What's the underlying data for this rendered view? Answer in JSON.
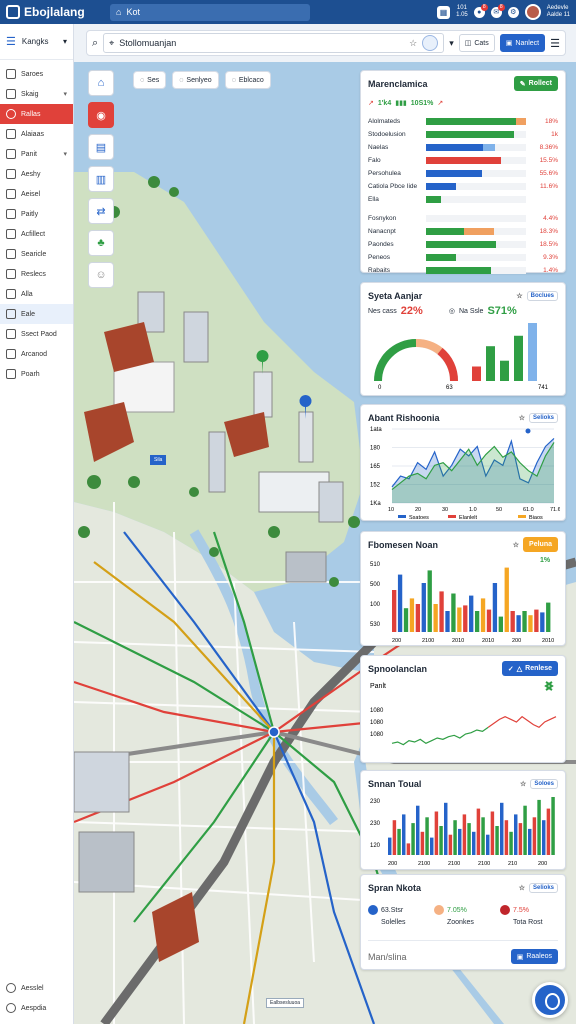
{
  "app": {
    "title": "Ebojlalang",
    "tab": "Kot"
  },
  "topbar": {
    "stack_line1": "101",
    "stack_line2": "1.05",
    "badge1": "8",
    "badge2": "8",
    "user_line1": "Aedevle",
    "user_line2": "Aalde 11"
  },
  "sidebar": {
    "header": "Kangks",
    "items": [
      {
        "label": "Saroes",
        "state": ""
      },
      {
        "label": "Skaig",
        "state": "caret"
      },
      {
        "label": "Rallas",
        "state": "active"
      },
      {
        "label": "Alaiaas",
        "state": ""
      },
      {
        "label": "Panit",
        "state": "caret"
      },
      {
        "label": "Aeshy",
        "state": ""
      },
      {
        "label": "Aeisel",
        "state": ""
      },
      {
        "label": "Paitly",
        "state": ""
      },
      {
        "label": "Acfillect",
        "state": ""
      },
      {
        "label": "Searicle",
        "state": ""
      },
      {
        "label": "Reslecs",
        "state": ""
      },
      {
        "label": "Alla",
        "state": ""
      },
      {
        "label": "Eale",
        "state": "hl"
      },
      {
        "label": "Ssect Paod",
        "state": ""
      },
      {
        "label": "Arcanod",
        "state": ""
      },
      {
        "label": "Poarh",
        "state": ""
      }
    ],
    "footer": [
      {
        "label": "Aesslel"
      },
      {
        "label": "Aespdia"
      }
    ]
  },
  "search": {
    "value": "Stollomuanjan",
    "btn_cats": "Cats",
    "btn_primary": "Nanlect"
  },
  "chips": [
    "Ses",
    "Senlyeo",
    "Eblcaco"
  ],
  "map": {
    "labels": {
      "station": "Sila",
      "bottom": "Ealbsesluuoa"
    }
  },
  "panels": {
    "p1": {
      "title": "Marenclamica",
      "button": "Rollect",
      "header_left": "1'k4",
      "header_pct": "10S1%",
      "rows": [
        {
          "label": "Alolmateds",
          "value": "18%",
          "segs": [
            {
              "c": "#2f9e44",
              "w": 0.9
            },
            {
              "c": "#f0a060",
              "w": 0.1
            }
          ]
        },
        {
          "label": "Stodoelusion",
          "value": "1k",
          "segs": [
            {
              "c": "#2f9e44",
              "w": 0.88
            }
          ]
        },
        {
          "label": "Naelas",
          "value": "8.36%",
          "segs": [
            {
              "c": "#2563c9",
              "w": 0.57
            },
            {
              "c": "#7fb2ea",
              "w": 0.12
            }
          ]
        },
        {
          "label": "Falo",
          "value": "15.5%",
          "segs": [
            {
              "c": "#e0413a",
              "w": 0.75
            }
          ]
        },
        {
          "label": "Persohulea",
          "value": "55.6%",
          "segs": [
            {
              "c": "#2563c9",
              "w": 0.56
            }
          ]
        },
        {
          "label": "Catiola Pbce Iide",
          "value": "11.6%",
          "segs": [
            {
              "c": "#2563c9",
              "w": 0.3
            }
          ]
        },
        {
          "label": "Ella",
          "value": "",
          "segs": [
            {
              "c": "#2f9e44",
              "w": 0.15
            }
          ]
        }
      ],
      "rows2": [
        {
          "label": "Fosnykon",
          "value": "4.4%",
          "segs": []
        },
        {
          "label": "Nanacnpt",
          "value": "18.3%",
          "segs": [
            {
              "c": "#2f9e44",
              "w": 0.38
            },
            {
              "c": "#f0a060",
              "w": 0.3
            }
          ]
        },
        {
          "label": "Paondes",
          "value": "18.5%",
          "segs": [
            {
              "c": "#2f9e44",
              "w": 0.7
            }
          ]
        },
        {
          "label": "Peneos",
          "value": "9.3%",
          "segs": [
            {
              "c": "#2f9e44",
              "w": 0.3
            }
          ]
        },
        {
          "label": "Rabaits",
          "value": "1.4%",
          "segs": [
            {
              "c": "#2f9e44",
              "w": 0.65
            }
          ]
        }
      ]
    },
    "p2": {
      "title": "Syeta Aanjar",
      "tab": "Boclues",
      "sub_left": "Nes cass",
      "kpi1": "22%",
      "sub_mid": "Na  Ssle",
      "kpi2": "S71%",
      "gauge_left": "0",
      "gauge_right": "63",
      "bars_axis_right": "741"
    },
    "p3": {
      "title": "Abant Rishoonia",
      "tab": "Selioks",
      "legend": "Ssatoes",
      "legend2": "Elanlelt",
      "legend3": "Biaos",
      "yticks": [
        "1ata",
        "180",
        "165",
        "152",
        "1Ka"
      ],
      "xticks": [
        "10",
        "20",
        "30",
        "1.0",
        "50",
        "61.0",
        "71.6"
      ]
    },
    "p4": {
      "title": "Fbomesen Noan",
      "button": "Peluna",
      "kpi": "1%",
      "yticks": [
        "510",
        "500",
        "100",
        "530"
      ],
      "xticks": [
        "200",
        "2100",
        "2010",
        "2010",
        "200",
        "2010"
      ]
    },
    "p5": {
      "title": "Spnoolanclan",
      "button": "Renlese",
      "sub": "Panlt",
      "yticks": [
        "1080",
        "1080",
        "1080"
      ]
    },
    "p6": {
      "title": "Snnan Toual",
      "tab": "Soloes",
      "yticks": [
        "230",
        "230",
        "120"
      ],
      "xticks": [
        "200",
        "2100",
        "2100",
        "2100",
        "210",
        "200"
      ]
    },
    "p7": {
      "title": "Spran Nkota",
      "tab": "Selioks",
      "s1_val": "63.Stsr",
      "s1_lbl": "Solelles",
      "s2_val": "7.05%",
      "s2_lbl": "Zoonkes",
      "s3_val": "7.5%",
      "s3_lbl": "Tota Rost",
      "footer_text": "Man/slina",
      "footer_btn": "Raaleos"
    }
  },
  "chart_data": [
    {
      "type": "bar",
      "title": "Marenclamica",
      "categories": [
        "Alolmateds",
        "Stodoelusion",
        "Naelas",
        "Falo",
        "Persohulea",
        "Catiola Pbce Iide",
        "Fosnykon",
        "Nanacnpt",
        "Paondes",
        "Peneos",
        "Rabaits"
      ],
      "values": [
        18,
        0,
        8.36,
        15.5,
        55.6,
        11.6,
        4.4,
        18.3,
        18.5,
        9.3,
        1.4
      ]
    },
    {
      "type": "bar",
      "title": "Syeta Aanjar",
      "values": [
        25,
        60,
        35,
        78,
        100
      ],
      "colors": [
        "#e0413a",
        "#2f9e44",
        "#2f9e44",
        "#2f9e44",
        "#7fb2ea"
      ]
    },
    {
      "type": "area",
      "title": "Abant Rishoonia",
      "series": [
        {
          "values": [
            142,
            150,
            148,
            160,
            155,
            168,
            150,
            158,
            170,
            165,
            172,
            150,
            162,
            158,
            176,
            148,
            145,
            160,
            172,
            178
          ]
        },
        {
          "values": [
            140,
            145,
            150,
            152,
            148,
            158,
            160,
            154,
            162,
            170,
            158,
            166,
            172,
            164,
            168,
            160,
            154,
            150,
            165,
            175
          ]
        }
      ]
    },
    {
      "type": "bar",
      "title": "Fbomesen Noan",
      "values": [
        60,
        82,
        34,
        48,
        40,
        70,
        88,
        40,
        58,
        30,
        55,
        35,
        38,
        52,
        30,
        48,
        32,
        70,
        22,
        92,
        30,
        24,
        30,
        24,
        32,
        28,
        42
      ],
      "colors": [
        "#e0413a",
        "#2563c9",
        "#2f9e44",
        "#f5a623"
      ]
    },
    {
      "type": "line",
      "title": "Spnoolanclan",
      "values": [
        40,
        41,
        39,
        42,
        41,
        43,
        40,
        42,
        44,
        43,
        45,
        46,
        44,
        47,
        48,
        50,
        49,
        52,
        55,
        58,
        60,
        58,
        56,
        60,
        57,
        54,
        52,
        56,
        58,
        60
      ]
    },
    {
      "type": "bar",
      "title": "Snnan Toual",
      "values": [
        30,
        60,
        45,
        70,
        20,
        55,
        85,
        40,
        65,
        30,
        75,
        50,
        90,
        35,
        60,
        45,
        70,
        55,
        40,
        80,
        65,
        35,
        75,
        50,
        90,
        60,
        40,
        70,
        55,
        85,
        45,
        65,
        95,
        60,
        80,
        100
      ],
      "colors": [
        "#2563c9",
        "#e0413a",
        "#2f9e44"
      ]
    },
    {
      "type": "pie",
      "title": "Spran Nkota",
      "values": [
        63,
        7.05,
        7.5
      ]
    }
  ]
}
